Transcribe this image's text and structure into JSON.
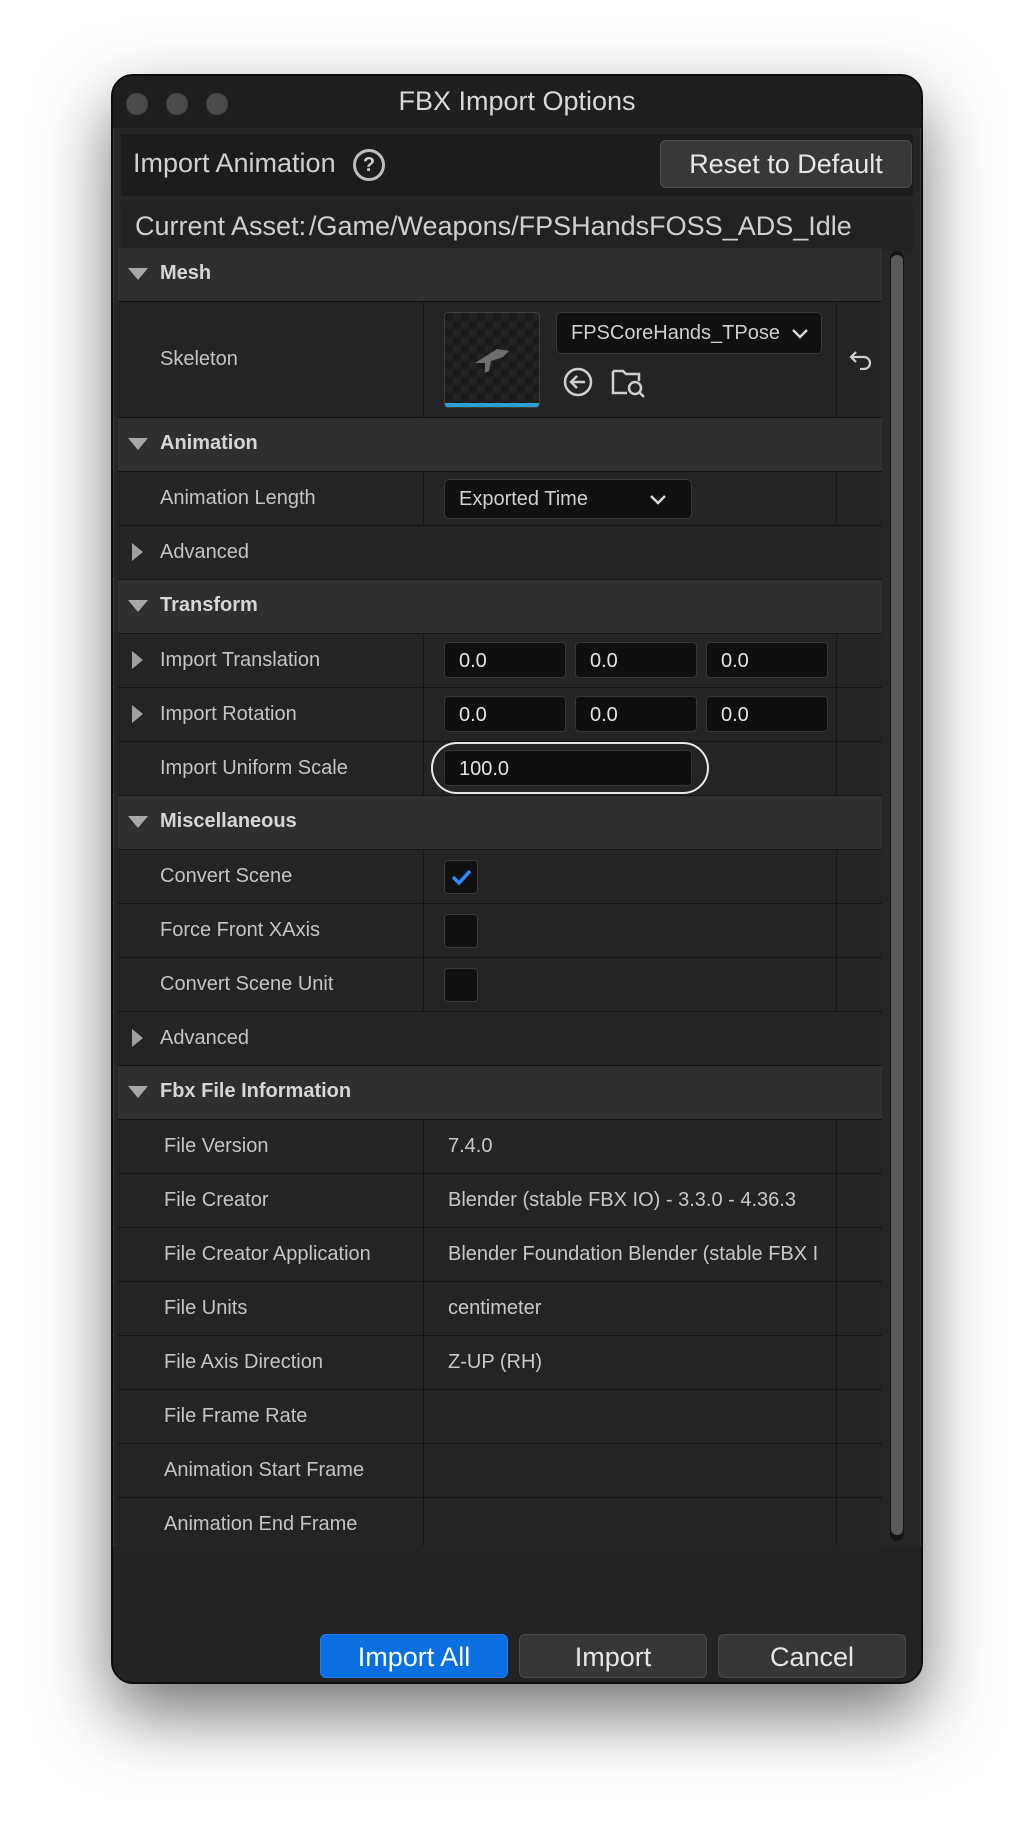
{
  "window": {
    "title": "FBX Import Options"
  },
  "header": {
    "label": "Import Animation",
    "reset_label": "Reset to Default"
  },
  "asset": {
    "label": "Current Asset:",
    "path": "/Game/Weapons/FPSHandsFOSS_ADS_Idle"
  },
  "sections": {
    "mesh": {
      "title": "Mesh",
      "skeleton_label": "Skeleton",
      "skeleton_value": "FPSCoreHands_TPose"
    },
    "animation": {
      "title": "Animation",
      "length_label": "Animation Length",
      "length_value": "Exported Time",
      "advanced_label": "Advanced"
    },
    "transform": {
      "title": "Transform",
      "translation_label": "Import Translation",
      "translation": [
        "0.0",
        "0.0",
        "0.0"
      ],
      "rotation_label": "Import Rotation",
      "rotation": [
        "0.0",
        "0.0",
        "0.0"
      ],
      "scale_label": "Import Uniform Scale",
      "scale_value": "100.0"
    },
    "misc": {
      "title": "Miscellaneous",
      "convert_scene_label": "Convert Scene",
      "convert_scene_checked": true,
      "force_front_label": "Force Front XAxis",
      "force_front_checked": false,
      "convert_unit_label": "Convert Scene Unit",
      "convert_unit_checked": false,
      "advanced_label": "Advanced"
    },
    "fbx_info": {
      "title": "Fbx File Information",
      "rows": [
        {
          "label": "File Version",
          "value": "7.4.0"
        },
        {
          "label": "File Creator",
          "value": "Blender (stable FBX IO) - 3.3.0 - 4.36.3"
        },
        {
          "label": "File Creator Application",
          "value": "Blender Foundation Blender (stable FBX I"
        },
        {
          "label": "File Units",
          "value": "centimeter"
        },
        {
          "label": "File Axis Direction",
          "value": "Z-UP (RH)"
        },
        {
          "label": "File Frame Rate",
          "value": ""
        },
        {
          "label": "Animation Start Frame",
          "value": ""
        },
        {
          "label": "Animation End Frame",
          "value": ""
        }
      ]
    }
  },
  "footer": {
    "import_all": "Import All",
    "import": "Import",
    "cancel": "Cancel"
  },
  "colors": {
    "accent": "#0a6fe0",
    "checkmark": "#2f8cff",
    "thumb_bar": "#2aa1d8"
  }
}
